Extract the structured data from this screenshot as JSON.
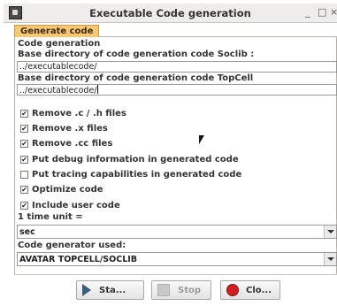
{
  "window": {
    "title": "Executable Code generation",
    "minimize_glyph": "_",
    "maximize_glyph": "□",
    "close_glyph": "×"
  },
  "tab": {
    "label": "Generate code"
  },
  "section": {
    "title": "Code generation"
  },
  "soclib": {
    "label": "Base directory of code generation code Soclib :",
    "value": "../executablecode/"
  },
  "topcell": {
    "label": "Base directory of code generation code TopCell",
    "value": "../executablecode/"
  },
  "options": [
    {
      "label": "Remove .c / .h files",
      "checked": true
    },
    {
      "label": "Remove .x files",
      "checked": true
    },
    {
      "label": "Remove .cc files",
      "checked": true
    },
    {
      "label": "Put debug information in generated code",
      "checked": true
    },
    {
      "label": "Put tracing capabilities in generated code",
      "checked": false
    },
    {
      "label": "Optimize code",
      "checked": true
    },
    {
      "label": "Include user code",
      "checked": true
    }
  ],
  "time_unit": {
    "label": "1 time unit =",
    "selected": "sec"
  },
  "generator": {
    "label": "Code generator used:",
    "selected": "AVATAR TOPCELL/SOCLIB"
  },
  "buttons": {
    "start_label": "Sta...",
    "stop_label": "Stop",
    "close_label": "Clo..."
  },
  "icons": {
    "app": "app-icon",
    "start": "play-icon",
    "stop": "stop-square-icon",
    "close": "red-circle-icon",
    "pointer": "mouse-pointer-icon"
  },
  "colors": {
    "tab_accent": "#f7c873",
    "play_icon": "#3d5a80",
    "close_icon": "#d02020"
  }
}
